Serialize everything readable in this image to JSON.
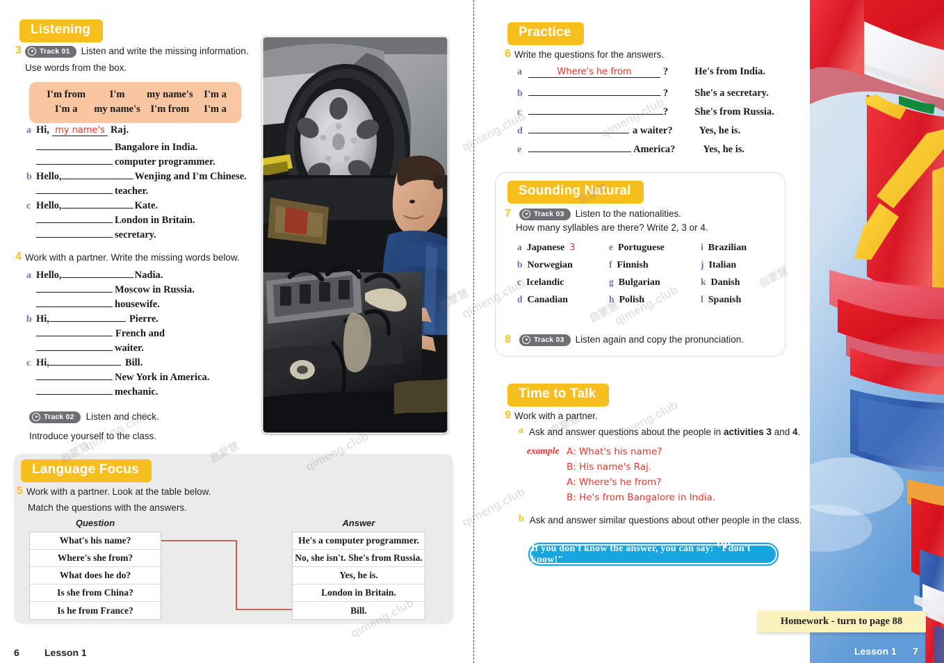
{
  "colors": {
    "accent_yellow": "#f7bf1e",
    "word_box": "#f8c6a0",
    "answer_red": "#e8362b",
    "tip_blue": "#18a6e0",
    "homework_yellow": "#fbf2bd",
    "letter_purple": "#7c6fb0",
    "panel_gray": "#ececed"
  },
  "watermark": {
    "text": "qimeng.club",
    "text_cn": "启蒙慧"
  },
  "left_page": {
    "listening": {
      "title": "Listening",
      "ex3": {
        "number": "3",
        "track": {
          "label": "Track 01",
          "icon": "disc-icon"
        },
        "instruction_line1": "Listen and write the missing information.",
        "instruction_line2": "Use words from the box.",
        "word_box": [
          [
            "I'm from",
            "I'm",
            "my name's",
            "I'm a"
          ],
          [
            "I'm a",
            "my name's",
            "I'm from",
            "I'm a"
          ]
        ],
        "items": [
          {
            "letter": "a",
            "lines": [
              {
                "pre": "Hi,",
                "answer": "my name's",
                "post": "Raj."
              },
              {
                "pre": "",
                "answer": "",
                "post": "Bangalore in India."
              },
              {
                "pre": "",
                "answer": "",
                "post": "computer programmer."
              }
            ]
          },
          {
            "letter": "b",
            "lines": [
              {
                "pre": "Hello,",
                "answer": "",
                "post": "Wenjing and I'm Chinese."
              },
              {
                "pre": "",
                "answer": "",
                "post": "teacher."
              }
            ]
          },
          {
            "letter": "c",
            "lines": [
              {
                "pre": "Hello,",
                "answer": "",
                "post": "Kate."
              },
              {
                "pre": "",
                "answer": "",
                "post": "London in Britain."
              },
              {
                "pre": "",
                "answer": "",
                "post": "secretary."
              }
            ]
          }
        ]
      },
      "ex4": {
        "number": "4",
        "instruction": "Work with a partner. Write the missing words below.",
        "items": [
          {
            "letter": "a",
            "lines": [
              {
                "pre": "Hello,",
                "post": "Nadia."
              },
              {
                "pre": "",
                "post": "Moscow in Russia."
              },
              {
                "pre": "",
                "post": "housewife."
              }
            ]
          },
          {
            "letter": "b",
            "lines": [
              {
                "pre": "Hi,",
                "post": "Pierre."
              },
              {
                "pre": "",
                "post": "French and"
              },
              {
                "pre": "",
                "post": "waiter."
              }
            ]
          },
          {
            "letter": "c",
            "lines": [
              {
                "pre": "Hi,",
                "post": "Bill."
              },
              {
                "pre": "",
                "post": "New York in America."
              },
              {
                "pre": "",
                "post": "mechanic."
              }
            ]
          }
        ],
        "track": {
          "label": "Track 02",
          "icon": "disc-icon"
        },
        "track_text": "Listen and check.",
        "closing": "Introduce yourself to the class."
      }
    },
    "language_focus": {
      "title": "Language Focus",
      "ex5": {
        "number": "5",
        "instruction_line1": "Work with a partner. Look at the table below.",
        "instruction_line2": "Match the questions with the answers."
      },
      "table": {
        "col1_header": "Question",
        "col2_header": "Answer",
        "questions": [
          "What's his name?",
          "Where's she from?",
          "What does he do?",
          "Is she from China?",
          "Is he from France?"
        ],
        "answers": [
          "He's a computer programmer.",
          "No, she isn't. She's from Russia.",
          "Yes, he is.",
          "London in Britain.",
          "Bill."
        ],
        "match_line": {
          "from_row": 0,
          "to_row": 4,
          "color": "#c0392b"
        }
      }
    },
    "photo": {
      "name": "mechanic-photo",
      "alt": "Mechanic working on a car engine under a lifted vehicle"
    },
    "footer": {
      "page": "6",
      "lesson": "Lesson 1"
    }
  },
  "right_page": {
    "practice": {
      "title": "Practice",
      "ex6": {
        "number": "6",
        "instruction": "Write the questions for the answers.",
        "items": [
          {
            "letter": "a",
            "answer_written": "Where's he from",
            "suffix": "?",
            "response": "He's from India."
          },
          {
            "letter": "b",
            "answer_written": "",
            "suffix": "?",
            "response": "She's a secretary."
          },
          {
            "letter": "c",
            "answer_written": "",
            "suffix": "?",
            "response": "She's from Russia."
          },
          {
            "letter": "d",
            "answer_written": "",
            "suffix": "a waiter?",
            "response": "Yes, he is."
          },
          {
            "letter": "e",
            "answer_written": "",
            "suffix": "America?",
            "response": "Yes, he is."
          }
        ]
      }
    },
    "sounding_natural": {
      "title": "Sounding Natural",
      "ex7": {
        "number": "7",
        "track": {
          "label": "Track 03",
          "icon": "disc-icon"
        },
        "instruction_line1": "Listen to the nationalities.",
        "instruction_line2": "How many syllables are there? Write 2, 3 or 4.",
        "nationalities": [
          {
            "letter": "a",
            "word": "Japanese",
            "value": "3"
          },
          {
            "letter": "b",
            "word": "Norwegian",
            "value": ""
          },
          {
            "letter": "c",
            "word": "Icelandic",
            "value": ""
          },
          {
            "letter": "d",
            "word": "Canadian",
            "value": ""
          },
          {
            "letter": "e",
            "word": "Portuguese",
            "value": ""
          },
          {
            "letter": "f",
            "word": "Finnish",
            "value": ""
          },
          {
            "letter": "g",
            "word": "Bulgarian",
            "value": ""
          },
          {
            "letter": "h",
            "word": "Polish",
            "value": ""
          },
          {
            "letter": "i",
            "word": "Brazilian",
            "value": ""
          },
          {
            "letter": "j",
            "word": "Italian",
            "value": ""
          },
          {
            "letter": "k",
            "word": "Danish",
            "value": ""
          },
          {
            "letter": "l",
            "word": "Spanish",
            "value": ""
          }
        ]
      },
      "ex8": {
        "number": "8",
        "track": {
          "label": "Track 03",
          "icon": "disc-icon"
        },
        "instruction": "Listen again and copy the pronunciation."
      }
    },
    "time_to_talk": {
      "title": "Time to Talk",
      "ex9": {
        "number": "9",
        "instruction": "Work with a partner.",
        "sub_a_letter": "a",
        "sub_a_pre": "Ask and answer questions about the people in ",
        "sub_a_bold1": "activities 3",
        "sub_a_mid": " and ",
        "sub_a_bold2": "4",
        "sub_a_post": ".",
        "example_label": "example",
        "example_lines": [
          "A: What's his name?",
          "B: His name's Raj.",
          "A: Where's he from?",
          "B: He's from Bangalore in India."
        ],
        "sub_b_letter": "b",
        "sub_b_text": "Ask and answer similar questions about other people in the class."
      },
      "tip": {
        "label": "tip",
        "text": "If you don't know the answer, you can say: \"I don't know!\""
      }
    },
    "homework": "Homework - turn to page 88",
    "photo": {
      "name": "flags-photo",
      "alt": "Colourful national flags against a blue sky"
    },
    "footer": {
      "lesson": "Lesson 1",
      "page": "7"
    }
  }
}
